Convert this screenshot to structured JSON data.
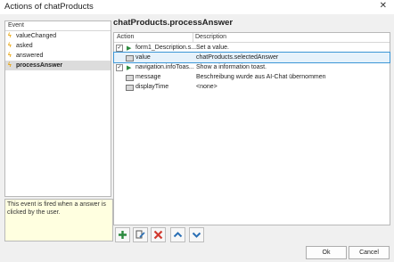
{
  "window": {
    "title": "Actions of chatProducts",
    "close_symbol": "✕"
  },
  "events": {
    "header": "Event",
    "items": [
      {
        "label": "valueChanged"
      },
      {
        "label": "asked"
      },
      {
        "label": "answered"
      },
      {
        "label": "processAnswer"
      }
    ],
    "description": "This event is fired when a answer is clicked by the user."
  },
  "actions": {
    "heading": "chatProducts.processAnswer",
    "col_action": "Action",
    "col_description": "Description",
    "rows": [
      {
        "name": "form1_Description.s...",
        "value": "Set a value."
      },
      {
        "name": "value",
        "value": "chatProducts.selectedAnswer"
      },
      {
        "name": "navigation.infoToas...",
        "value": "Show a information toast."
      },
      {
        "name": "message",
        "value": "Beschreibung wurde aus AI-Chat übernommen"
      },
      {
        "name": "displayTime",
        "value": "<none>"
      }
    ]
  },
  "toolbar": {
    "add_icon": "add-icon",
    "edit_icon": "edit-icon",
    "delete_icon": "delete-icon",
    "up_icon": "up-arrow-icon",
    "down_icon": "down-arrow-icon"
  },
  "buttons": {
    "ok": "Ok",
    "cancel": "Cancel"
  },
  "colors": {
    "accent": "#3b96d6",
    "add": "#2b8a3e",
    "delete": "#d13a2f",
    "arrows": "#2a6fb5"
  }
}
